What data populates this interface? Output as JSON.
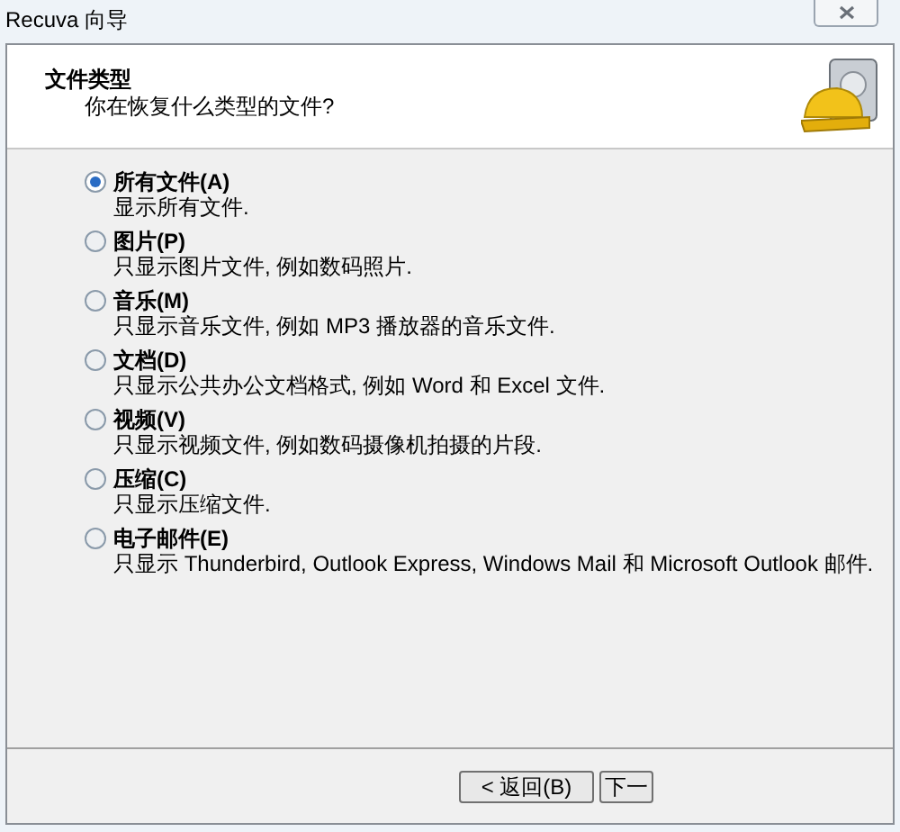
{
  "window": {
    "title": "Recuva 向导"
  },
  "header": {
    "title": "文件类型",
    "subtitle": "你在恢复什么类型的文件?"
  },
  "options": [
    {
      "label": "所有文件(A)",
      "description": "显示所有文件.",
      "selected": true
    },
    {
      "label": "图片(P)",
      "description": "只显示图片文件, 例如数码照片.",
      "selected": false
    },
    {
      "label": "音乐(M)",
      "description": "只显示音乐文件, 例如 MP3 播放器的音乐文件.",
      "selected": false
    },
    {
      "label": "文档(D)",
      "description": "只显示公共办公文档格式, 例如 Word 和 Excel 文件.",
      "selected": false
    },
    {
      "label": "视频(V)",
      "description": "只显示视频文件, 例如数码摄像机拍摄的片段.",
      "selected": false
    },
    {
      "label": "压缩(C)",
      "description": "只显示压缩文件.",
      "selected": false
    },
    {
      "label": "电子邮件(E)",
      "description": "只显示 Thunderbird, Outlook Express,  Windows Mail 和 Microsoft Outlook 邮件.",
      "selected": false
    }
  ],
  "buttons": [
    {
      "label": "< 返回(B)"
    },
    {
      "label": "下一"
    }
  ]
}
